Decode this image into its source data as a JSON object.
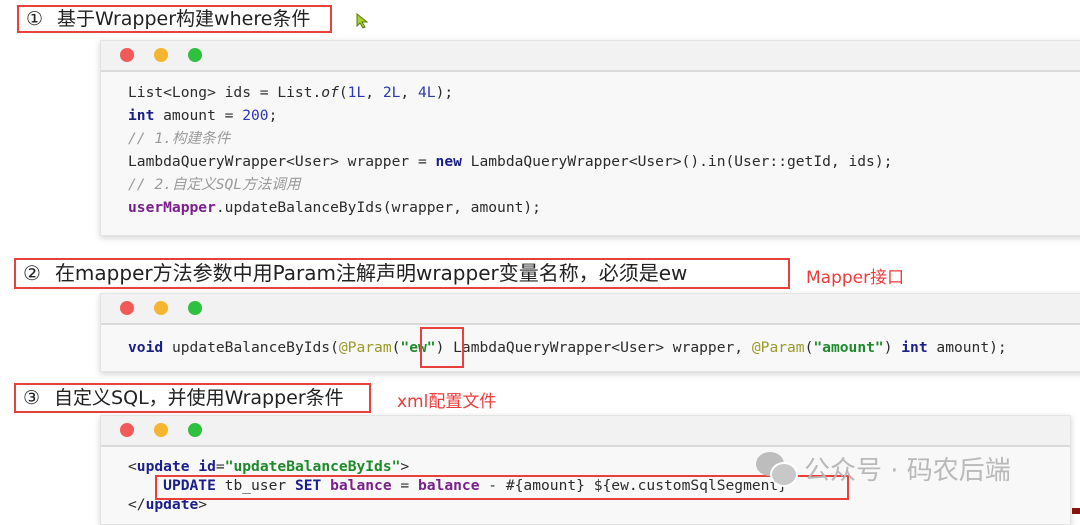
{
  "steps": [
    {
      "number": "①",
      "title": "基于Wrapper构建where条件",
      "note": "",
      "code_lines": [
        [
          {
            "t": "List<Long> ids = List."
          },
          {
            "t": "of",
            "c": "fn-it"
          },
          {
            "t": "("
          },
          {
            "t": "1L",
            "c": "num-lit"
          },
          {
            "t": ", "
          },
          {
            "t": "2L",
            "c": "num-lit"
          },
          {
            "t": ", "
          },
          {
            "t": "4L",
            "c": "num-lit"
          },
          {
            "t": ");"
          }
        ],
        [
          {
            "t": "int",
            "c": "kw"
          },
          {
            "t": " amount = "
          },
          {
            "t": "200",
            "c": "num-lit"
          },
          {
            "t": ";"
          }
        ],
        [
          {
            "t": "// 1.构建条件",
            "c": "cmt"
          }
        ],
        [
          {
            "t": "LambdaQueryWrapper<User> wrapper = "
          },
          {
            "t": "new",
            "c": "kw"
          },
          {
            "t": " LambdaQueryWrapper<User>().in(User::getId, ids);"
          }
        ],
        [
          {
            "t": "// 2.自定义SQL方法调用",
            "c": "cmt"
          }
        ],
        [
          {
            "t": "userMapper",
            "c": "field"
          },
          {
            "t": ".updateBalanceByIds(wrapper, amount);"
          }
        ]
      ]
    },
    {
      "number": "②",
      "title": "在mapper方法参数中用Param注解声明wrapper变量名称，必须是ew",
      "note": "Mapper接口",
      "code_lines": [
        [
          {
            "t": "void",
            "c": "kw"
          },
          {
            "t": " updateBalanceByIds("
          },
          {
            "t": "@Param",
            "c": "anno"
          },
          {
            "t": "("
          },
          {
            "t": "\"ew\"",
            "c": "str"
          },
          {
            "t": ") LambdaQueryWrapper<User> wrapper, "
          },
          {
            "t": "@Param",
            "c": "anno"
          },
          {
            "t": "("
          },
          {
            "t": "\"amount\"",
            "c": "str"
          },
          {
            "t": ") "
          },
          {
            "t": "int",
            "c": "kw"
          },
          {
            "t": " amount);"
          }
        ]
      ]
    },
    {
      "number": "③",
      "title": "自定义SQL，并使用Wrapper条件",
      "note": "xml配置文件",
      "code_lines": [
        [
          {
            "t": "<"
          },
          {
            "t": "update",
            "c": "xmltag"
          },
          {
            "t": " "
          },
          {
            "t": "id",
            "c": "xmlattr"
          },
          {
            "t": "="
          },
          {
            "t": "\"updateBalanceByIds\"",
            "c": "xmlval"
          },
          {
            "t": ">"
          }
        ],
        [
          {
            "t": "    "
          },
          {
            "t": "UPDATE",
            "c": "sqlkw"
          },
          {
            "t": " tb_user "
          },
          {
            "t": "SET",
            "c": "sqlkw"
          },
          {
            "t": " "
          },
          {
            "t": "balance",
            "c": "sqlcol"
          },
          {
            "t": " = "
          },
          {
            "t": "balance",
            "c": "sqlcol"
          },
          {
            "t": " - #{amount} ${ew.customSqlSegment}"
          }
        ],
        [
          {
            "t": "</"
          },
          {
            "t": "update",
            "c": "xmltag"
          },
          {
            "t": ">"
          }
        ]
      ]
    }
  ],
  "window_dots": [
    "close",
    "minimize",
    "maximize"
  ],
  "colors": {
    "highlight_border": "#e8413c",
    "note_text": "#ee3b3b",
    "dot_red": "#f25a5a",
    "dot_yellow": "#f5b52e",
    "dot_green": "#2fc03f"
  },
  "watermark": {
    "text": "公众号 · 码农后端",
    "icon": "wechat-icon"
  }
}
